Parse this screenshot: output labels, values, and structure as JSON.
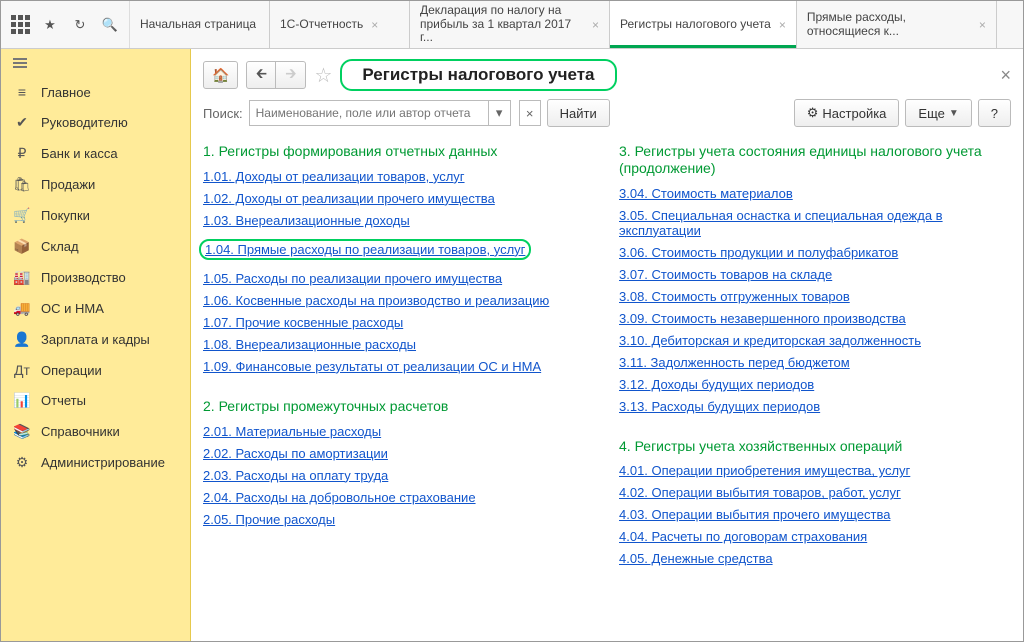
{
  "topbar": {
    "tabs": [
      {
        "label": "Начальная страница",
        "closable": false
      },
      {
        "label": "1С-Отчетность",
        "closable": true
      },
      {
        "label": "Декларация по налогу на прибыль за 1 квартал 2017 г...",
        "closable": true
      },
      {
        "label": "Регистры налогового учета",
        "closable": true,
        "active": true
      },
      {
        "label": "Прямые расходы, относящиеся к...",
        "closable": true
      }
    ]
  },
  "sidebar": {
    "items": [
      {
        "icon": "≡",
        "label": "Главное"
      },
      {
        "icon": "✔",
        "label": "Руководителю"
      },
      {
        "icon": "₽",
        "label": "Банк и касса"
      },
      {
        "icon": "🛍",
        "label": "Продажи"
      },
      {
        "icon": "🛒",
        "label": "Покупки"
      },
      {
        "icon": "📦",
        "label": "Склад"
      },
      {
        "icon": "🏭",
        "label": "Производство"
      },
      {
        "icon": "🚚",
        "label": "ОС и НМА"
      },
      {
        "icon": "👤",
        "label": "Зарплата и кадры"
      },
      {
        "icon": "Дт",
        "label": "Операции"
      },
      {
        "icon": "📊",
        "label": "Отчеты"
      },
      {
        "icon": "📚",
        "label": "Справочники"
      },
      {
        "icon": "⚙",
        "label": "Администрирование"
      }
    ]
  },
  "page": {
    "title": "Регистры налогового учета",
    "search_label": "Поиск:",
    "search_placeholder": "Наименование, поле или автор отчета",
    "find": "Найти",
    "settings": "Настройка",
    "more": "Еще",
    "help": "?"
  },
  "sections": {
    "col1": [
      {
        "title": "1. Регистры формирования отчетных данных",
        "items": [
          {
            "t": "1.01. Доходы от реализации товаров, услуг"
          },
          {
            "t": "1.02. Доходы от реализации прочего имущества"
          },
          {
            "t": "1.03. Внереализационные доходы"
          },
          {
            "t": "1.04. Прямые расходы по реализации товаров, услуг",
            "hl": true
          },
          {
            "t": "1.05. Расходы по реализации прочего имущества"
          },
          {
            "t": "1.06. Косвенные расходы на производство и реализацию"
          },
          {
            "t": "1.07. Прочие косвенные расходы"
          },
          {
            "t": "1.08. Внереализационные расходы"
          },
          {
            "t": "1.09. Финансовые результаты от реализации ОС и НМА"
          }
        ]
      },
      {
        "title": "2. Регистры промежуточных расчетов",
        "items": [
          {
            "t": "2.01. Материальные расходы"
          },
          {
            "t": "2.02. Расходы по амортизации"
          },
          {
            "t": "2.03. Расходы на оплату труда"
          },
          {
            "t": "2.04. Расходы на добровольное страхование"
          },
          {
            "t": "2.05. Прочие расходы"
          }
        ]
      }
    ],
    "col2": [
      {
        "title": "3. Регистры учета состояния единицы налогового учета (продолжение)",
        "items": [
          {
            "t": "3.04. Стоимость материалов"
          },
          {
            "t": "3.05. Специальная оснастка и специальная одежда в эксплуатации"
          },
          {
            "t": "3.06. Стоимость продукции и полуфабрикатов"
          },
          {
            "t": "3.07. Стоимость товаров на складе"
          },
          {
            "t": "3.08. Стоимость отгруженных товаров"
          },
          {
            "t": "3.09. Стоимость незавершенного производства"
          },
          {
            "t": "3.10. Дебиторская и кредиторская задолженность"
          },
          {
            "t": "3.11. Задолженность перед бюджетом"
          },
          {
            "t": "3.12. Доходы будущих периодов"
          },
          {
            "t": "3.13. Расходы будущих периодов"
          }
        ]
      },
      {
        "title": "4. Регистры учета хозяйственных операций",
        "items": [
          {
            "t": "4.01. Операции приобретения имущества, услуг"
          },
          {
            "t": "4.02. Операции выбытия товаров, работ, услуг"
          },
          {
            "t": "4.03. Операции выбытия прочего имущества"
          },
          {
            "t": "4.04. Расчеты по договорам страхования"
          },
          {
            "t": "4.05. Денежные средства"
          }
        ]
      }
    ]
  }
}
